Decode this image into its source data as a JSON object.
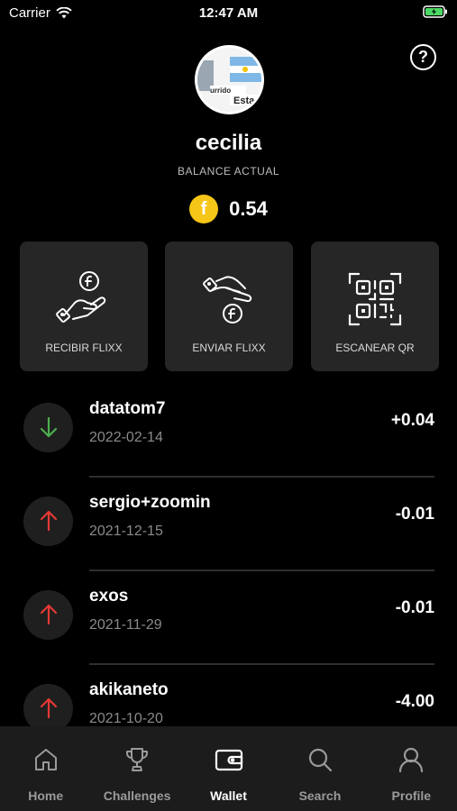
{
  "status_bar": {
    "carrier": "Carrier",
    "time": "12:47 AM"
  },
  "profile": {
    "username": "cecilia",
    "balance_label": "BALANCE ACTUAL",
    "balance": "0.54",
    "coin_symbol": "f",
    "avatar_text_1": "urrido",
    "avatar_text_2": "Esta"
  },
  "actions": [
    {
      "label": "RECIBIR FLIXX",
      "icon": "receive-coin-hand-icon"
    },
    {
      "label": "ENVIAR FLIXX",
      "icon": "send-coin-hand-icon"
    },
    {
      "label": "ESCANEAR QR",
      "icon": "qr-code-icon"
    }
  ],
  "transactions": [
    {
      "name": "datatom7",
      "date": "2022-02-14",
      "amount": "+0.04",
      "direction": "in"
    },
    {
      "name": "sergio+zoomin",
      "date": "2021-12-15",
      "amount": "-0.01",
      "direction": "out"
    },
    {
      "name": "exos",
      "date": "2021-11-29",
      "amount": "-0.01",
      "direction": "out"
    },
    {
      "name": "akikaneto",
      "date": "2021-10-20",
      "amount": "-4.00",
      "direction": "out"
    }
  ],
  "tabs": [
    {
      "label": "Home",
      "icon": "home-icon",
      "active": false
    },
    {
      "label": "Challenges",
      "icon": "trophy-icon",
      "active": false
    },
    {
      "label": "Wallet",
      "icon": "wallet-icon",
      "active": true
    },
    {
      "label": "Search",
      "icon": "search-icon",
      "active": false
    },
    {
      "label": "Profile",
      "icon": "profile-icon",
      "active": false
    }
  ],
  "colors": {
    "incoming": "#4caf50",
    "outgoing": "#e53935",
    "coin": "#f5c518",
    "battery": "#4cd964"
  }
}
